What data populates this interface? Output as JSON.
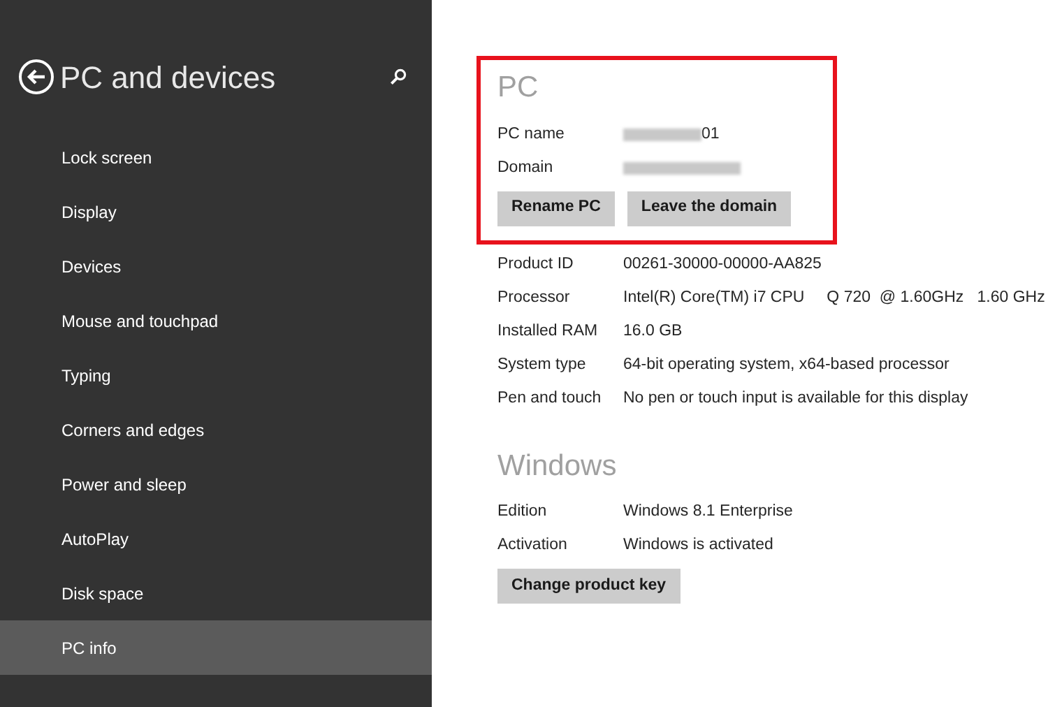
{
  "sidebar": {
    "title": "PC and devices",
    "items": [
      {
        "label": "Lock screen",
        "selected": false
      },
      {
        "label": "Display",
        "selected": false
      },
      {
        "label": "Devices",
        "selected": false
      },
      {
        "label": "Mouse and touchpad",
        "selected": false
      },
      {
        "label": "Typing",
        "selected": false
      },
      {
        "label": "Corners and edges",
        "selected": false
      },
      {
        "label": "Power and sleep",
        "selected": false
      },
      {
        "label": "AutoPlay",
        "selected": false
      },
      {
        "label": "Disk space",
        "selected": false
      },
      {
        "label": "PC info",
        "selected": true
      }
    ]
  },
  "sections": [
    {
      "title": "PC",
      "highlighted": true,
      "fields": [
        {
          "label": "PC name",
          "value": "01",
          "redacted": true
        },
        {
          "label": "Domain",
          "redacted": true
        }
      ],
      "buttons": [
        "Rename PC",
        "Leave the domain"
      ],
      "details": [
        {
          "label": "Product ID",
          "value": "00261-30000-00000-AA825"
        },
        {
          "label": "Processor",
          "value": "Intel(R) Core(TM) i7 CPU     Q 720  @ 1.60GHz   1.60 GHz"
        },
        {
          "label": "Installed RAM",
          "value": "16.0 GB"
        },
        {
          "label": "System type",
          "value": "64-bit operating system, x64-based processor"
        },
        {
          "label": "Pen and touch",
          "value": "No pen or touch input is available for this display"
        }
      ]
    },
    {
      "title": "Windows",
      "highlighted": false,
      "fields": [
        {
          "label": "Edition",
          "value": "Windows 8.1 Enterprise"
        },
        {
          "label": "Activation",
          "value": "Windows is activated"
        }
      ],
      "buttons": [
        "Change product key"
      ]
    }
  ]
}
